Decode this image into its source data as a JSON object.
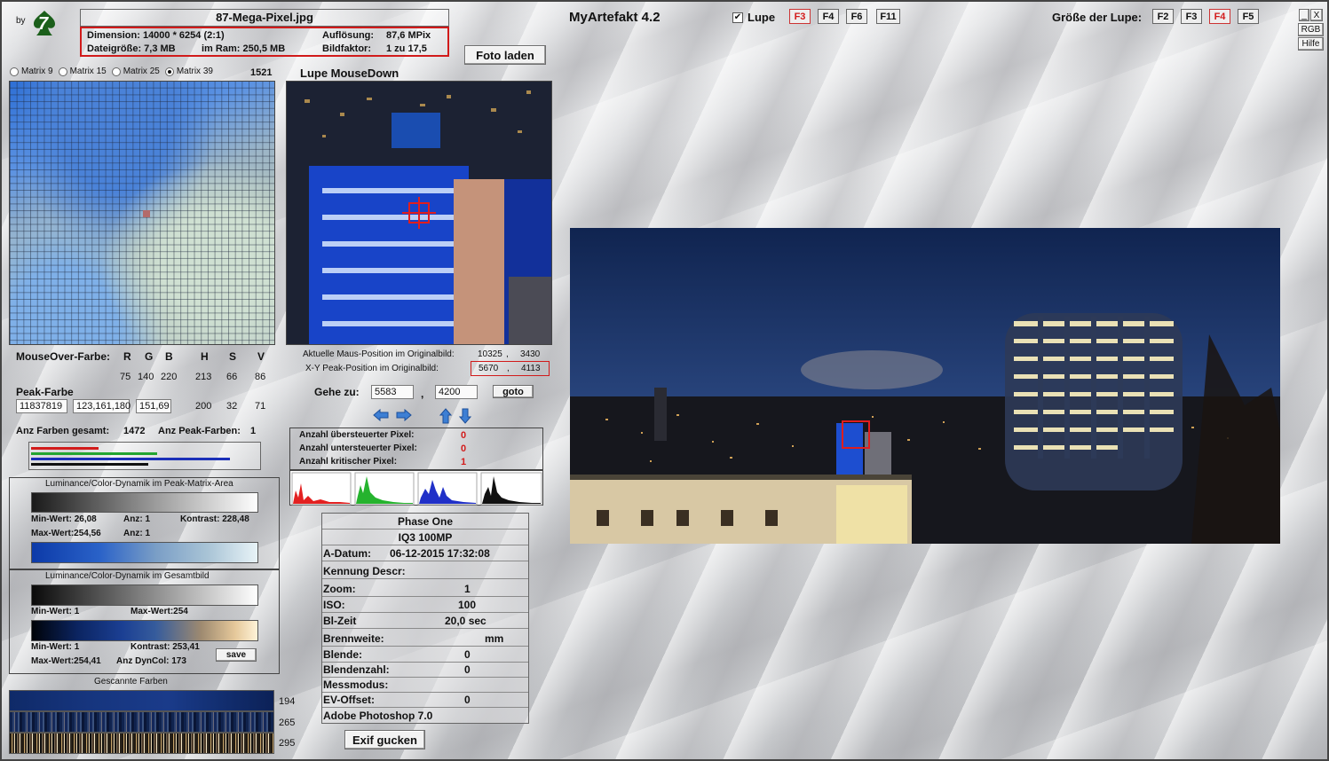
{
  "logo": {
    "by": "by",
    "mark": "7"
  },
  "app_title": "MyArtefakt 4.2",
  "file": {
    "name": "87-Mega-Pixel.jpg",
    "dimension": "Dimension: 14000 * 6254 (2:1)",
    "resolution_label": "Auflösung:",
    "resolution_value": "87,6 MPix",
    "filesize": "Dateigröße: 7,3 MB",
    "ram": "im Ram: 250,5 MB",
    "factor_label": "Bildfaktor:",
    "factor_value": "1 zu 17,5"
  },
  "buttons": {
    "load_photo": "Foto laden",
    "goto": "goto",
    "save": "save",
    "exif": "Exif gucken",
    "rgb": "RGB",
    "help": "Hilfe",
    "minimize": "_",
    "close": "X"
  },
  "lupe": {
    "checkbox_label": "Lupe",
    "checked": true,
    "keys": [
      "F3",
      "F4",
      "F6",
      "F11"
    ],
    "active_key": "F3",
    "size_label": "Größe der Lupe:",
    "size_keys": [
      "F2",
      "F3",
      "F4",
      "F5"
    ],
    "active_size_key": "F4",
    "panel_title": "Lupe MouseDown"
  },
  "matrix": {
    "options": [
      "Matrix 9",
      "Matrix 15",
      "Matrix 25",
      "Matrix 39"
    ],
    "selected": "Matrix 39",
    "count": "1521"
  },
  "positions": {
    "mouse_label": "Aktuelle Maus-Position  im Originalbild:",
    "mouse_x": "10325",
    "mouse_y": "3430",
    "peak_label": "X-Y Peak-Position  im Originalbild:",
    "peak_x": "5670",
    "peak_y": "4113",
    "goto_label": "Gehe zu:",
    "goto_x": "5583",
    "goto_y": "4200",
    "separator": ","
  },
  "colors": {
    "mouseover_label": "MouseOver-Farbe:",
    "headers": [
      "R",
      "G",
      "B",
      "H",
      "S",
      "V"
    ],
    "mouseover_values": [
      "75",
      "140",
      "220",
      "213",
      "66",
      "86"
    ],
    "peak_label": "Peak-Farbe",
    "peak_field_1": "11837819",
    "peak_field_2": "123,161,180",
    "peak_field_3": "151,69",
    "peak_hsv": [
      "200",
      "32",
      "71"
    ],
    "total_label": "Anz Farben gesamt:",
    "total_value": "1472",
    "peak_count_label": "Anz Peak-Farben:",
    "peak_count_value": "1"
  },
  "pixel_stats": {
    "over_label": "Anzahl übersteuerter Pixel:",
    "over_value": "0",
    "under_label": "Anzahl untersteuerter Pixel:",
    "under_value": "0",
    "critical_label": "Anzahl kritischer Pixel:",
    "critical_value": "1"
  },
  "dyn_peak": {
    "title": "Luminance/Color-Dynamik im Peak-Matrix-Area",
    "min": "Min-Wert: 26,08",
    "min_anz": "Anz:  1",
    "contrast": "Kontrast:  228,48",
    "max": "Max-Wert:254,56",
    "max_anz": "Anz:  1"
  },
  "dyn_total": {
    "title": "Luminance/Color-Dynamik im Gesamtbild",
    "min": "Min-Wert: 1",
    "max": "Max-Wert:254",
    "min2": "Min-Wert: 1",
    "contrast": "Kontrast:  253,41",
    "max2": "Max-Wert:254,41",
    "dyncol": "Anz DynCol:  173"
  },
  "scanned": {
    "title": "Gescannte Farben",
    "counts": [
      "194",
      "265",
      "295"
    ]
  },
  "exif": {
    "camera": "Phase One",
    "model": "IQ3 100MP",
    "date_label": "A-Datum:",
    "date_value": "06-12-2015 17:32:08",
    "descr_label": "Kennung Descr:",
    "zoom_label": "Zoom:",
    "zoom_value": "1",
    "iso_label": "ISO:",
    "iso_value": "100",
    "exposure_label": "Bl-Zeit",
    "exposure_value": "20,0 sec",
    "focal_label": "Brennweite:",
    "focal_unit": "mm",
    "aperture_label": "Blende:",
    "aperture_value": "0",
    "fnumber_label": "Blendenzahl:",
    "fnumber_value": "0",
    "metering_label": "Messmodus:",
    "ev_label": "EV-Offset:",
    "ev_value": "0",
    "software": "Adobe Photoshop 7.0"
  },
  "histogram_bars": {
    "red": [
      0.85,
      1.0
    ],
    "green": [
      0.55,
      0.1
    ],
    "blue": [
      0.9,
      0.1
    ],
    "black": [
      0.55,
      0.1
    ]
  },
  "accent_colors": {
    "red": "#d21b1b",
    "blue": "#1f3fa8",
    "green": "#23a531"
  }
}
